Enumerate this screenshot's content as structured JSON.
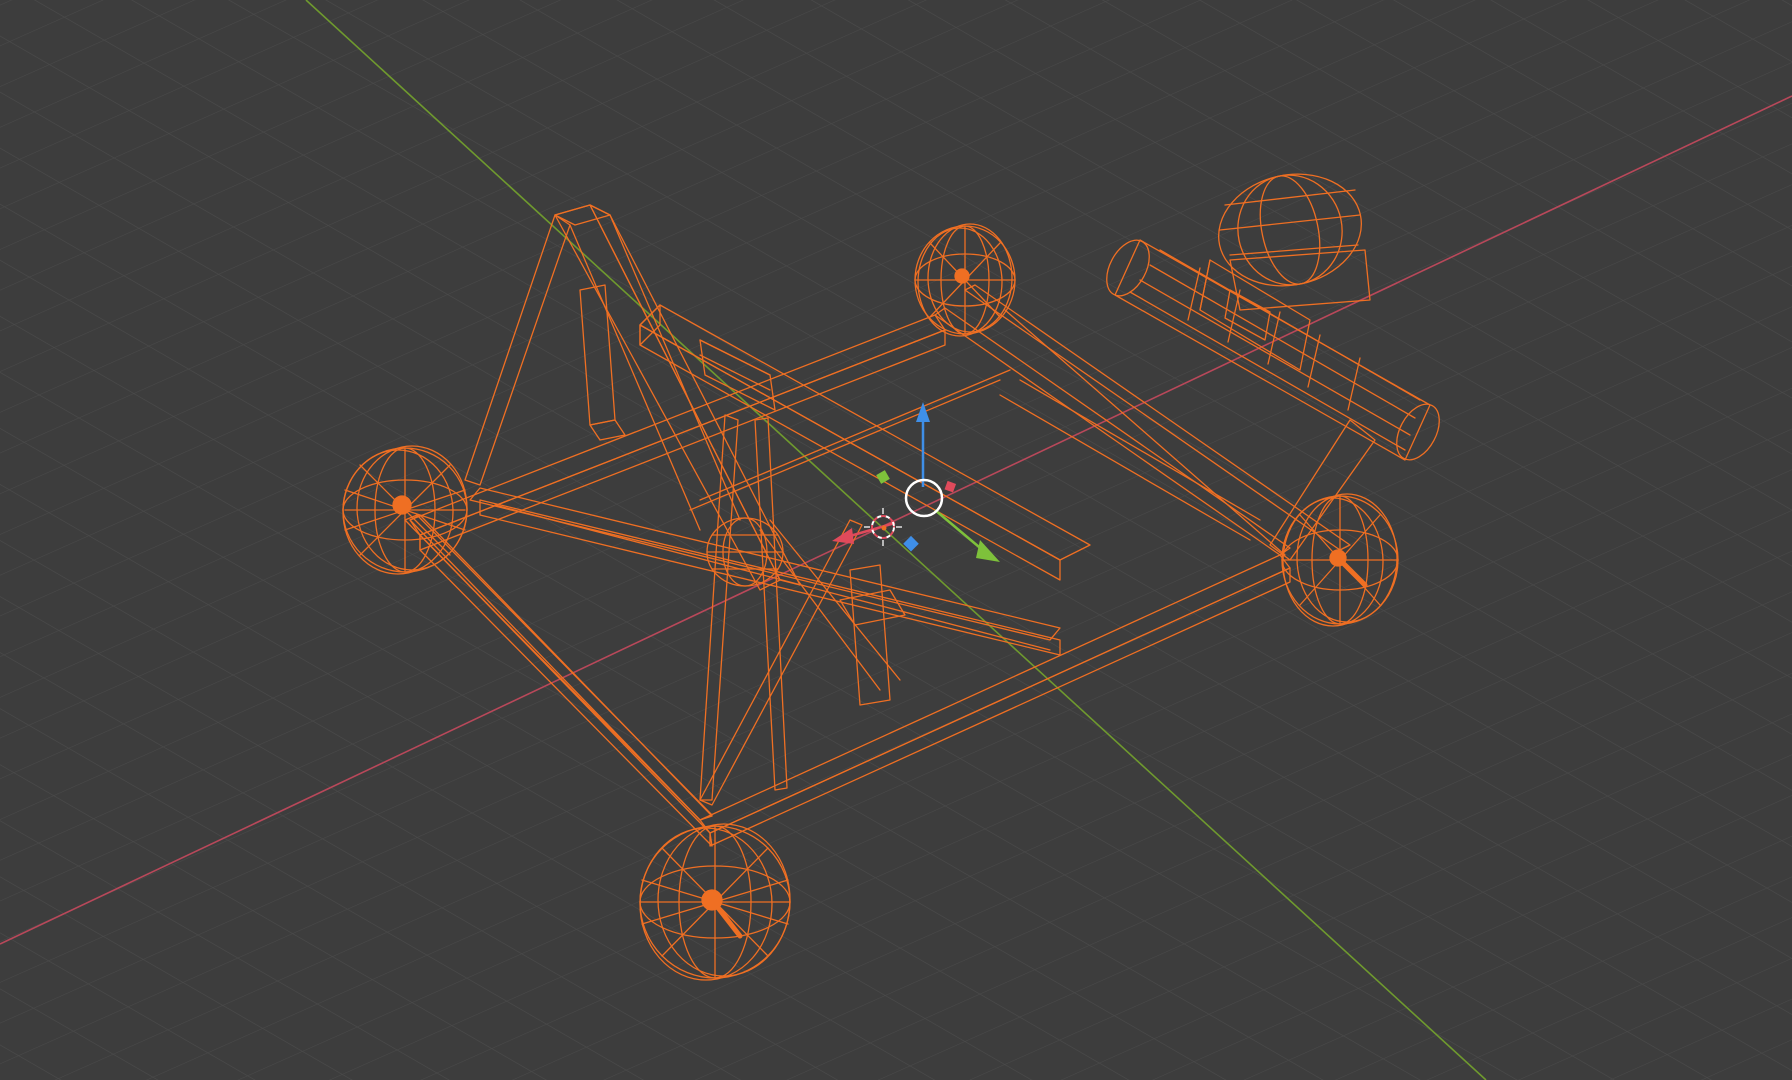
{
  "viewport": {
    "background": "#3d3d3d",
    "grid_color": "#4b4b4b",
    "x_axis_color": "#b9485a",
    "y_axis_color": "#6f9a2e",
    "selection_color": "#ef6f23"
  },
  "scene": {
    "object": "catapult-wireframe",
    "display_mode": "wireframe",
    "selected": true
  },
  "gizmo": {
    "icon": "move-gizmo-icon",
    "axis_z_color": "#3f8fe8",
    "axis_y_color": "#7ec13b",
    "axis_x_color": "#e04a5b",
    "pivot_color": "#ffffff"
  }
}
